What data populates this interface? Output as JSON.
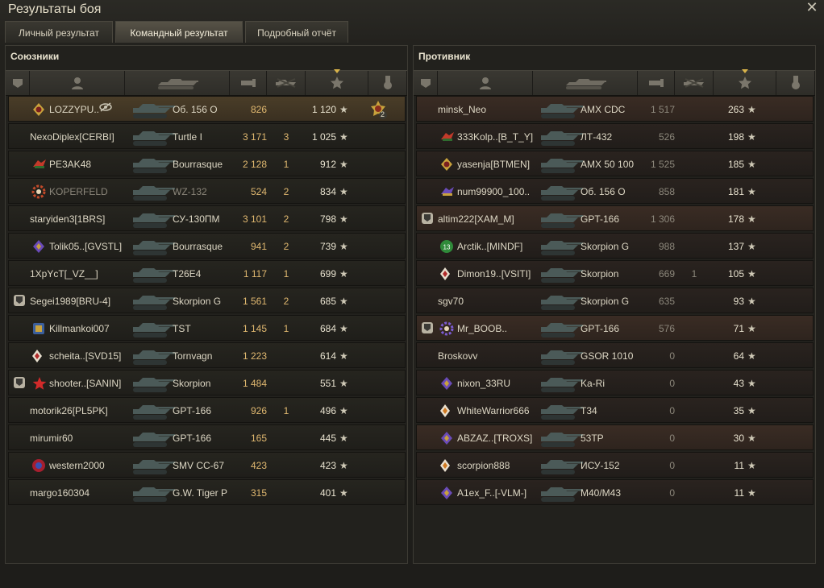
{
  "window": {
    "title": "Результаты боя"
  },
  "tabs": [
    {
      "label": "Личный результат"
    },
    {
      "label": "Командный результат"
    },
    {
      "label": "Подробный отчёт"
    }
  ],
  "allies": {
    "title": "Союзники",
    "rows": [
      {
        "name": "LOZZYPU..",
        "tank": "Об. 156 О",
        "damage": "826",
        "kills": "",
        "xp": "1 120",
        "badge": false,
        "emblem": "gold-diamond",
        "self": true,
        "medal": "2"
      },
      {
        "name": "NexoDiplex[CERBI]",
        "tank": "Turtle I",
        "damage": "3 171",
        "kills": "3",
        "xp": "1 025",
        "badge": false,
        "emblem": ""
      },
      {
        "name": "PE3AK48",
        "tank": "Bourrasque",
        "damage": "2 128",
        "kills": "1",
        "xp": "912",
        "badge": false,
        "emblem": "red-wings"
      },
      {
        "name": "KOPERFELD",
        "tank": "WZ-132",
        "damage": "524",
        "kills": "2",
        "xp": "834",
        "badge": false,
        "emblem": "red-gear",
        "dead": true
      },
      {
        "name": "staryiden3[1BRS]",
        "tank": "СУ-130ПМ",
        "damage": "3 101",
        "kills": "2",
        "xp": "798",
        "badge": false,
        "emblem": ""
      },
      {
        "name": "Tolik05..[GVSTL]",
        "tank": "Bourrasque",
        "damage": "941",
        "kills": "2",
        "xp": "739",
        "badge": false,
        "emblem": "purple-diamond"
      },
      {
        "name": "1XpYcT[_VZ__]",
        "tank": "T26E4",
        "damage": "1 117",
        "kills": "1",
        "xp": "699",
        "badge": false,
        "emblem": ""
      },
      {
        "name": "Segei1989[BRU-4]",
        "tank": "Skorpion G",
        "damage": "1 561",
        "kills": "2",
        "xp": "685",
        "badge": true,
        "emblem": ""
      },
      {
        "name": "Killmankoi007",
        "tank": "TST",
        "damage": "1 145",
        "kills": "1",
        "xp": "684",
        "badge": false,
        "emblem": "blue-cube"
      },
      {
        "name": "scheita..[SVD15]",
        "tank": "Tornvagn",
        "damage": "1 223",
        "kills": "",
        "xp": "614",
        "badge": false,
        "emblem": "red-diamond-small"
      },
      {
        "name": "shooter..[SANIN]",
        "tank": "Skorpion",
        "damage": "1 484",
        "kills": "",
        "xp": "551",
        "badge": true,
        "emblem": "red-star"
      },
      {
        "name": "motorik26[PL5PK]",
        "tank": "GPT-166",
        "damage": "926",
        "kills": "1",
        "xp": "496",
        "badge": false,
        "emblem": ""
      },
      {
        "name": "mirumir60",
        "tank": "GPT-166",
        "damage": "165",
        "kills": "",
        "xp": "445",
        "badge": false,
        "emblem": ""
      },
      {
        "name": "western2000",
        "tank": "SMV CC-67",
        "damage": "423",
        "kills": "",
        "xp": "423",
        "badge": false,
        "emblem": "red-circle"
      },
      {
        "name": "margo160304",
        "tank": "G.W. Tiger P",
        "damage": "315",
        "kills": "",
        "xp": "401",
        "badge": false,
        "emblem": ""
      }
    ]
  },
  "enemies": {
    "title": "Противник",
    "rows": [
      {
        "name": "minsk_Neo",
        "tank": "AMX CDC",
        "damage": "1 517",
        "kills": "",
        "xp": "263",
        "badge": false,
        "emblem": ""
      },
      {
        "name": "333Kolp..[B_T_Y]",
        "tank": "ЛТ-432",
        "damage": "526",
        "kills": "",
        "xp": "198",
        "badge": false,
        "emblem": "red-wings"
      },
      {
        "name": "yasenja[BTMEN]",
        "tank": "AMX 50 100",
        "damage": "1 525",
        "kills": "",
        "xp": "185",
        "badge": false,
        "emblem": "gold-diamond"
      },
      {
        "name": "num99900_100..",
        "tank": "Об. 156 О",
        "damage": "858",
        "kills": "",
        "xp": "181",
        "badge": false,
        "emblem": "purple-wings"
      },
      {
        "name": "altim222[XAM_M]",
        "tank": "GPT-166",
        "damage": "1 306",
        "kills": "",
        "xp": "178",
        "badge": true,
        "emblem": ""
      },
      {
        "name": "Arctik..[MINDF]",
        "tank": "Skorpion G",
        "damage": "988",
        "kills": "",
        "xp": "137",
        "badge": false,
        "emblem": "green-13"
      },
      {
        "name": "Dimon19..[VSITI]",
        "tank": "Skorpion",
        "damage": "669",
        "kills": "1",
        "xp": "105",
        "badge": false,
        "emblem": "red-diamond-small"
      },
      {
        "name": "sgv70",
        "tank": "Skorpion G",
        "damage": "635",
        "kills": "",
        "xp": "93",
        "badge": false,
        "emblem": ""
      },
      {
        "name": "Mr_BOOB..",
        "tank": "GPT-166",
        "damage": "576",
        "kills": "",
        "xp": "71",
        "badge": true,
        "emblem": "purple-gear"
      },
      {
        "name": "Broskovv",
        "tank": "GSOR 1010",
        "damage": "0",
        "kills": "",
        "xp": "64",
        "badge": false,
        "emblem": ""
      },
      {
        "name": "nixon_33RU",
        "tank": "Ka-Ri",
        "damage": "0",
        "kills": "",
        "xp": "43",
        "badge": false,
        "emblem": "purple-diamond"
      },
      {
        "name": "WhiteWarrior666",
        "tank": "T34",
        "damage": "0",
        "kills": "",
        "xp": "35",
        "badge": false,
        "emblem": "orange-diamond-small"
      },
      {
        "name": "ABZAZ..[TROXS]",
        "tank": "53TP",
        "damage": "0",
        "kills": "",
        "xp": "30",
        "badge": false,
        "emblem": "purple-diamond"
      },
      {
        "name": "scorpion888",
        "tank": "ИСУ-152",
        "damage": "0",
        "kills": "",
        "xp": "11",
        "badge": false,
        "emblem": "orange-diamond-small"
      },
      {
        "name": "A1ex_F..[-VLM-]",
        "tank": "M40/M43",
        "damage": "0",
        "kills": "",
        "xp": "11",
        "badge": false,
        "emblem": "purple-diamond"
      }
    ]
  },
  "icons": {
    "star": "★",
    "close": "✕"
  },
  "colors": {
    "accent_gold": "#e0b870",
    "self_row": "#4a3d28",
    "sort_marker": "#d8b34a"
  }
}
